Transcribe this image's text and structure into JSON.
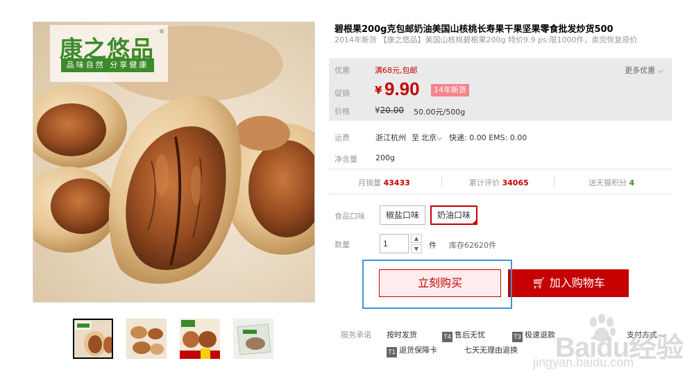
{
  "product": {
    "title": "碧根果200g克包邮奶油美国山核桃长寿果干果坚果零食批发炒货500",
    "subtitle": "2014年新货 【康之悠品】美国山核桃碧根果200g 特价9.9 ps:限1000件，卖完恢复原价"
  },
  "brand": {
    "name": "康之悠品",
    "slogan": "品味自然 分享健康",
    "reg_mark": "®"
  },
  "promo": {
    "label": "优惠",
    "value": "满68元,包邮",
    "more": "更多优惠"
  },
  "price": {
    "label": "促销",
    "currency": "¥",
    "current": "9.90",
    "tag": "14年新货",
    "orig_label": "价格",
    "orig_currency": "¥",
    "original": "20.00",
    "unit_price": "50.00元/500g"
  },
  "shipping": {
    "label": "运费",
    "from": "浙江杭州",
    "to_word": "至",
    "to": "北京",
    "fees": "快递: 0.00 EMS: 0.00"
  },
  "net_weight": {
    "label": "净含量",
    "value": "200g"
  },
  "stats": [
    {
      "label": "月销量",
      "value": "43433"
    },
    {
      "label": "累计评价",
      "value": "34065"
    },
    {
      "label": "送天猫积分",
      "value": "4"
    }
  ],
  "flavor": {
    "label": "食品口味",
    "options": [
      "椒盐口味",
      "奶油口味"
    ],
    "selected": "奶油口味"
  },
  "quantity": {
    "label": "数量",
    "value": "1",
    "unit": "件",
    "stock": "库存62620件"
  },
  "actions": {
    "buy_now": "立刻购买",
    "add_to_cart": "加入购物车"
  },
  "services": {
    "label": "服务承诺",
    "items": [
      {
        "icon": "",
        "text": "按时发货"
      },
      {
        "icon": "T4",
        "text": "售后无忧"
      },
      {
        "icon": "T3",
        "text": "极速退款"
      },
      {
        "icon": "",
        "text": "支付方式"
      },
      {
        "icon": "T1",
        "text": "退货保障卡"
      },
      {
        "icon": "",
        "text": "七天无理由退换"
      }
    ]
  },
  "watermark": {
    "brand": "Baidu经验",
    "url": "jingyan.baidu.com"
  },
  "colors": {
    "accent": "#c40000",
    "brand_green": "#3c8a2a",
    "highlight": "#3c95d8",
    "promo_bg": "#eaeaea"
  }
}
